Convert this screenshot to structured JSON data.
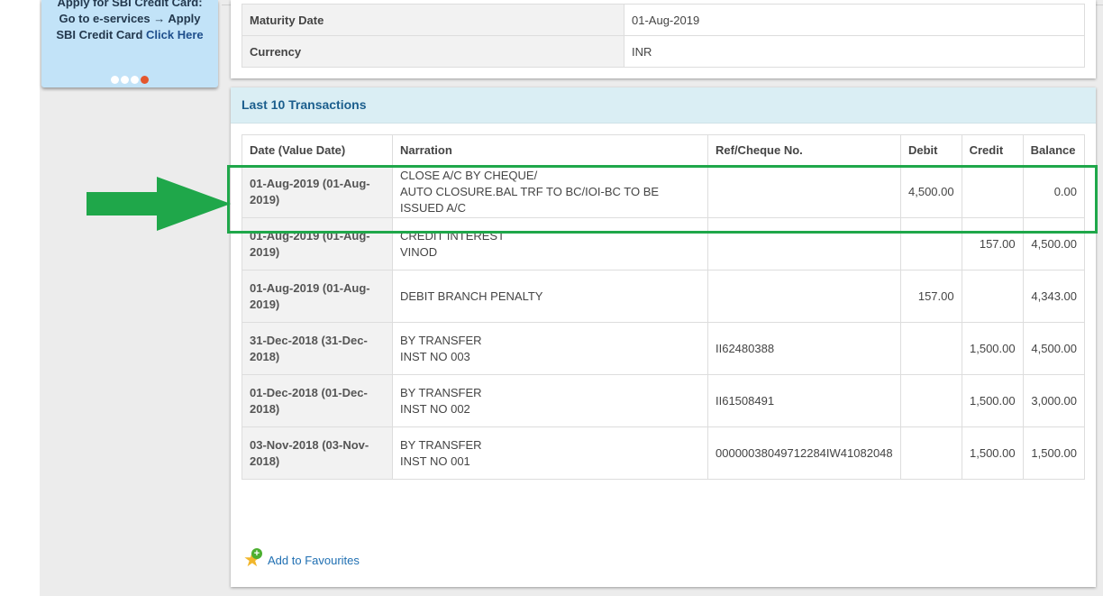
{
  "sidebar": {
    "promo": {
      "line1": "Apply for SBI Credit Card:",
      "line2": "Go to e-services → Apply",
      "line3_prefix": "SBI Credit Card ",
      "line3_link": "Click Here"
    }
  },
  "account_info": {
    "rows": [
      {
        "label": "Maturity Date",
        "value": "01-Aug-2019"
      },
      {
        "label": "Currency",
        "value": "INR"
      }
    ]
  },
  "transactions": {
    "title": "Last 10 Transactions",
    "columns": [
      "Date (Value Date)",
      "Narration",
      "Ref/Cheque No.",
      "Debit",
      "Credit",
      "Balance"
    ],
    "rows": [
      {
        "date_line1": "01-Aug-2019 (01-Aug-",
        "date_line2": "2019)",
        "narration_lines": [
          "CLOSE A/C BY CHEQUE/",
          "AUTO CLOSURE.BAL TRF TO BC/IOI-BC TO BE",
          "ISSUED A/C"
        ],
        "ref": "",
        "debit": "4,500.00",
        "credit": "",
        "balance": "0.00"
      },
      {
        "date_line1": "01-Aug-2019 (01-Aug-",
        "date_line2": "2019)",
        "narration_lines": [
          "CREDIT INTEREST",
          "VINOD"
        ],
        "ref": "",
        "debit": "",
        "credit": "157.00",
        "balance": "4,500.00"
      },
      {
        "date_line1": "01-Aug-2019 (01-Aug-",
        "date_line2": "2019)",
        "narration_lines": [
          "DEBIT BRANCH PENALTY"
        ],
        "ref": "",
        "debit": "157.00",
        "credit": "",
        "balance": "4,343.00"
      },
      {
        "date_line1": "31-Dec-2018 (31-Dec-",
        "date_line2": "2018)",
        "narration_lines": [
          "BY TRANSFER",
          "INST NO 003"
        ],
        "ref": "II62480388",
        "debit": "",
        "credit": "1,500.00",
        "balance": "4,500.00"
      },
      {
        "date_line1": "01-Dec-2018 (01-Dec-",
        "date_line2": "2018)",
        "narration_lines": [
          "BY TRANSFER",
          "INST NO 002"
        ],
        "ref": "II61508491",
        "debit": "",
        "credit": "1,500.00",
        "balance": "3,000.00"
      },
      {
        "date_line1": "03-Nov-2018 (03-Nov-",
        "date_line2": "2018)",
        "narration_lines": [
          "BY TRANSFER",
          "INST NO 001"
        ],
        "ref": "00000038049712284IW41082048",
        "debit": "",
        "credit": "1,500.00",
        "balance": "1,500.00"
      }
    ]
  },
  "favourites": {
    "label": "Add to Favourites",
    "icon": "star-plus-icon"
  },
  "annotation": {
    "highlight_color": "#1fa74a",
    "arrow_color": "#1fa74a",
    "highlighted_row": 0
  }
}
